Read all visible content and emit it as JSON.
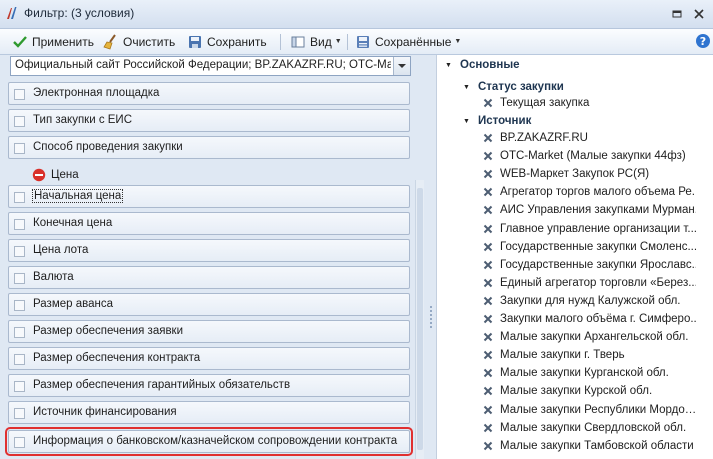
{
  "window": {
    "title": "Фильтр: (3 условия)"
  },
  "toolbar": {
    "apply_label": "Применить",
    "clear_label": "Очистить",
    "save_label": "Сохранить",
    "view_label": "Вид",
    "saved_label": "Сохранённые"
  },
  "left": {
    "combo_value": "Официальный сайт Российской Федерации; BP.ZAKAZRF.RU; ОТС-Мар...",
    "rows_top": [
      "Электронная площадка",
      "Тип закупки с ЕИС",
      "Способ проведения закупки"
    ],
    "group_label": "Цена",
    "rows_group": [
      "Начальная цена",
      "Конечная цена",
      "Цена лота",
      "Валюта",
      "Размер аванса",
      "Размер обеспечения заявки",
      "Размер обеспечения контракта",
      "Размер обеспечения гарантийных обязательств",
      "Источник финансирования",
      "Информация о банковском/казначейском сопровождении контракта"
    ]
  },
  "right": {
    "root_label": "Основные",
    "status_label": "Статус закупки",
    "status_items": [
      "Текущая закупка"
    ],
    "source_label": "Источник",
    "source_items": [
      "BP.ZAKAZRF.RU",
      "ОТС-Market (Малые закупки 44фз)",
      "WEB-Маркет Закупок РС(Я)",
      "Агрегатор торгов малого объема Ре...",
      "АИС Управления закупками Мурман...",
      "Главное управление организации т...",
      "Государственные закупки Смоленс...",
      "Государственные закупки Ярославс...",
      "Единый агрегатор торговли «Берез...",
      "Закупки для нужд Калужской обл.",
      "Закупки малого объёма г. Симферо...",
      "Малые закупки Архангельской обл.",
      "Малые закупки г. Тверь",
      "Малые закупки Курганской обл.",
      "Малые закупки Курской обл.",
      "Малые закупки Республики Мордовия",
      "Малые закупки Свердловской обл.",
      "Малые закупки Тамбовской области"
    ]
  },
  "colors": {
    "highlight": "#e03030",
    "remove_icon": "#d9302a",
    "apply_check": "#2f9a2f"
  }
}
